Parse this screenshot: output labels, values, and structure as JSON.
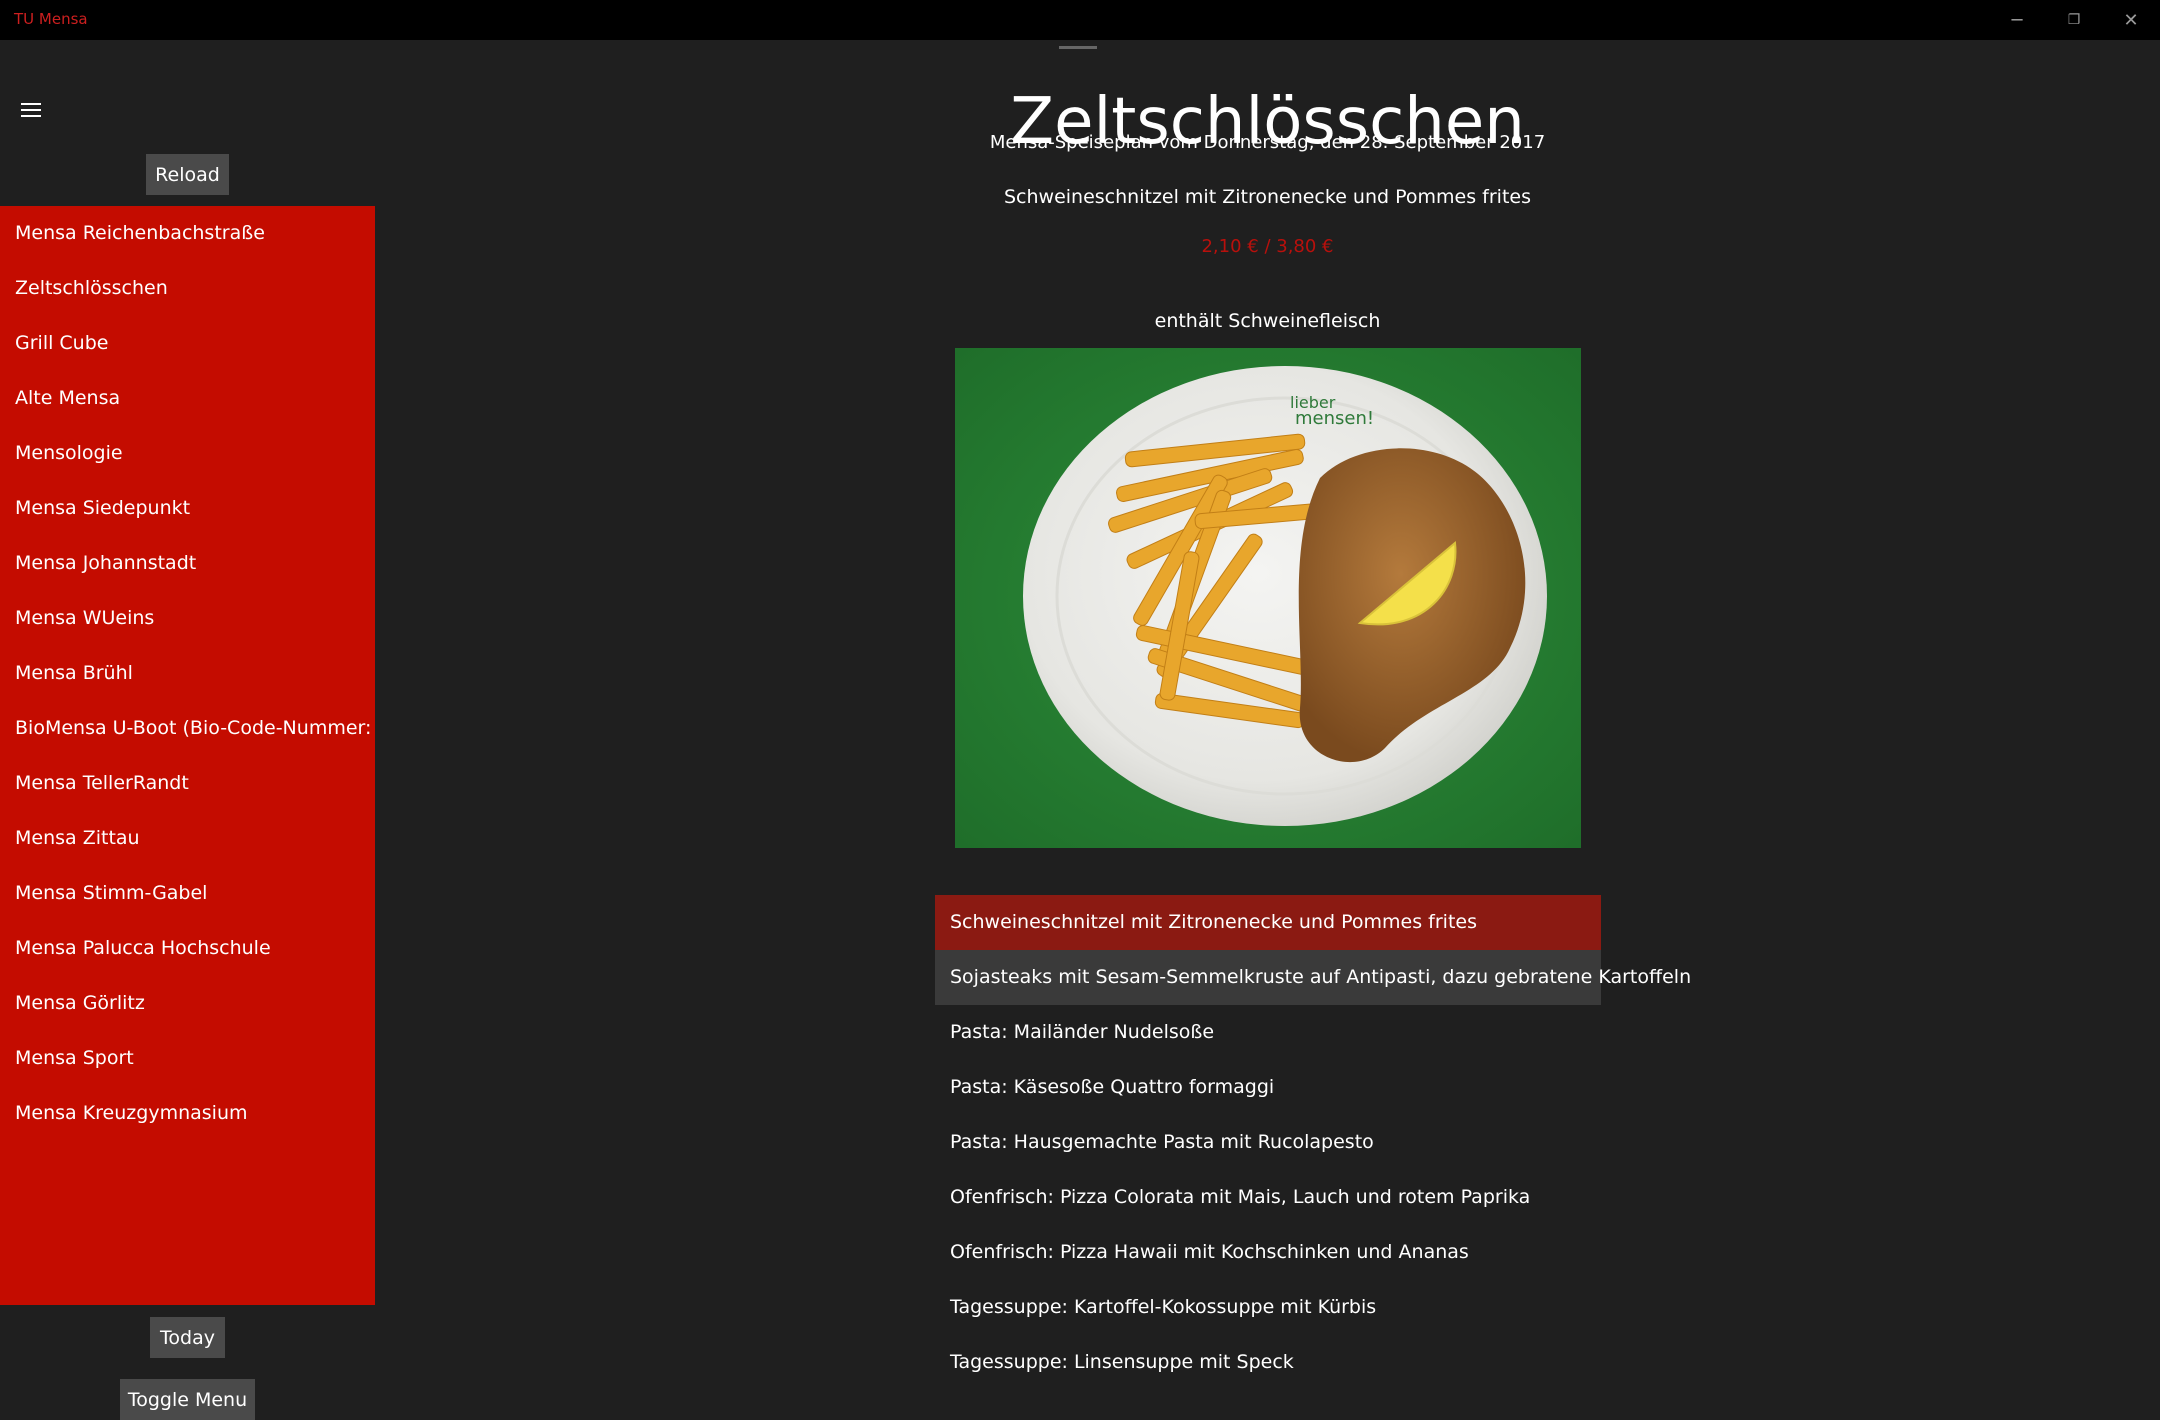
{
  "window": {
    "app_title": "TU Mensa",
    "minimize": "─",
    "restore": "❐",
    "close": "✕"
  },
  "sidebar": {
    "reload_label": "Reload",
    "items": [
      {
        "label": "Mensa Reichenbachstraße"
      },
      {
        "label": "Zeltschlösschen"
      },
      {
        "label": "Grill Cube"
      },
      {
        "label": "Alte Mensa"
      },
      {
        "label": "Mensologie"
      },
      {
        "label": "Mensa Siedepunkt"
      },
      {
        "label": "Mensa Johannstadt"
      },
      {
        "label": "Mensa WUeins"
      },
      {
        "label": "Mensa Brühl"
      },
      {
        "label": "BioMensa U-Boot (Bio-Code-Nummer: DE"
      },
      {
        "label": "Mensa TellerRandt"
      },
      {
        "label": "Mensa Zittau"
      },
      {
        "label": "Mensa Stimm-Gabel"
      },
      {
        "label": "Mensa Palucca Hochschule"
      },
      {
        "label": "Mensa Görlitz"
      },
      {
        "label": "Mensa Sport"
      },
      {
        "label": "Mensa Kreuzgymnasium"
      }
    ],
    "today_label": "Today",
    "toggle_label": "Toggle Menu",
    "accent_color": "#c40c00"
  },
  "main": {
    "title": "Zeltschlösschen",
    "subtitle": "Mensa-Speiseplan vom Donnerstag, den 28. September 2017",
    "selected_dish": {
      "name": "Schweineschnitzel mit Zitronenecke und Pommes frites",
      "price": "2,10 € / 3,80 €",
      "note": "enthält Schweinefleisch",
      "price_color": "#b8100c"
    },
    "menu": [
      {
        "label": "Schweineschnitzel mit Zitronenecke und Pommes frites",
        "state": "selected"
      },
      {
        "label": "Sojasteaks mit Sesam-Semmelkruste auf Antipasti, dazu gebratene Kartoffeln",
        "state": "hover"
      },
      {
        "label": "Pasta: Mailänder Nudelsoße",
        "state": ""
      },
      {
        "label": "Pasta: Käsesoße Quattro formaggi",
        "state": ""
      },
      {
        "label": "Pasta: Hausgemachte Pasta mit Rucolapesto",
        "state": ""
      },
      {
        "label": "Ofenfrisch: Pizza Colorata mit Mais, Lauch und rotem Paprika",
        "state": ""
      },
      {
        "label": "Ofenfrisch: Pizza Hawaii mit Kochschinken und Ananas",
        "state": ""
      },
      {
        "label": "Tagessuppe: Kartoffel-Kokossuppe mit Kürbis",
        "state": ""
      },
      {
        "label": "Tagessuppe: Linsensuppe mit Speck",
        "state": ""
      }
    ]
  }
}
